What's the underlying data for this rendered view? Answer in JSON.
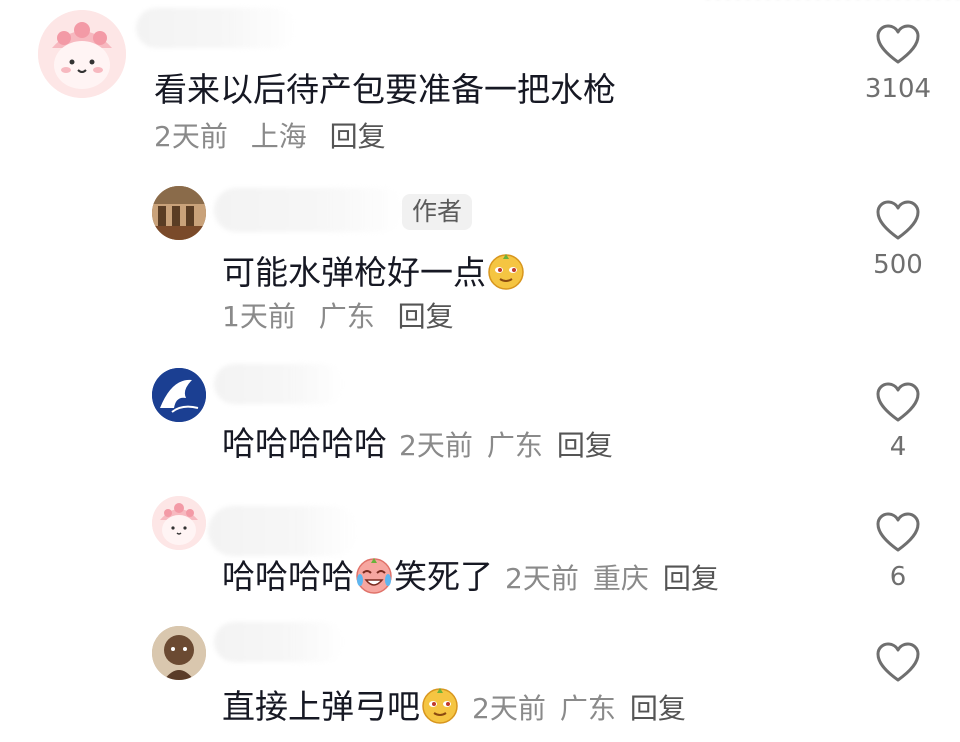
{
  "comments": [
    {
      "text": "看来以后待产包要准备一把水枪",
      "time": "2天前",
      "location": "上海",
      "reply": "回复",
      "likes": "3104"
    },
    {
      "author_tag": "作者",
      "text": "可能水弹枪好一点",
      "time": "1天前",
      "location": "广东",
      "reply": "回复",
      "likes": "500"
    },
    {
      "text": "哈哈哈哈哈",
      "time": "2天前",
      "location": "广东",
      "reply": "回复",
      "likes": "4"
    },
    {
      "text_before": "哈哈哈哈",
      "text_after": "笑死了",
      "time": "2天前",
      "location": "重庆",
      "reply": "回复",
      "likes": "6"
    },
    {
      "text": "直接上弹弓吧",
      "time": "2天前",
      "location": "广东",
      "reply": "回复"
    }
  ],
  "icons": {
    "like": "heart-outline-icon",
    "emoji_smug": "smug-face-emoji-icon",
    "emoji_cry_laugh": "crying-laughing-emoji-icon"
  },
  "colors": {
    "text": "#161823",
    "meta": "#8a8a8a",
    "heart_stroke": "#6f6f6f"
  }
}
